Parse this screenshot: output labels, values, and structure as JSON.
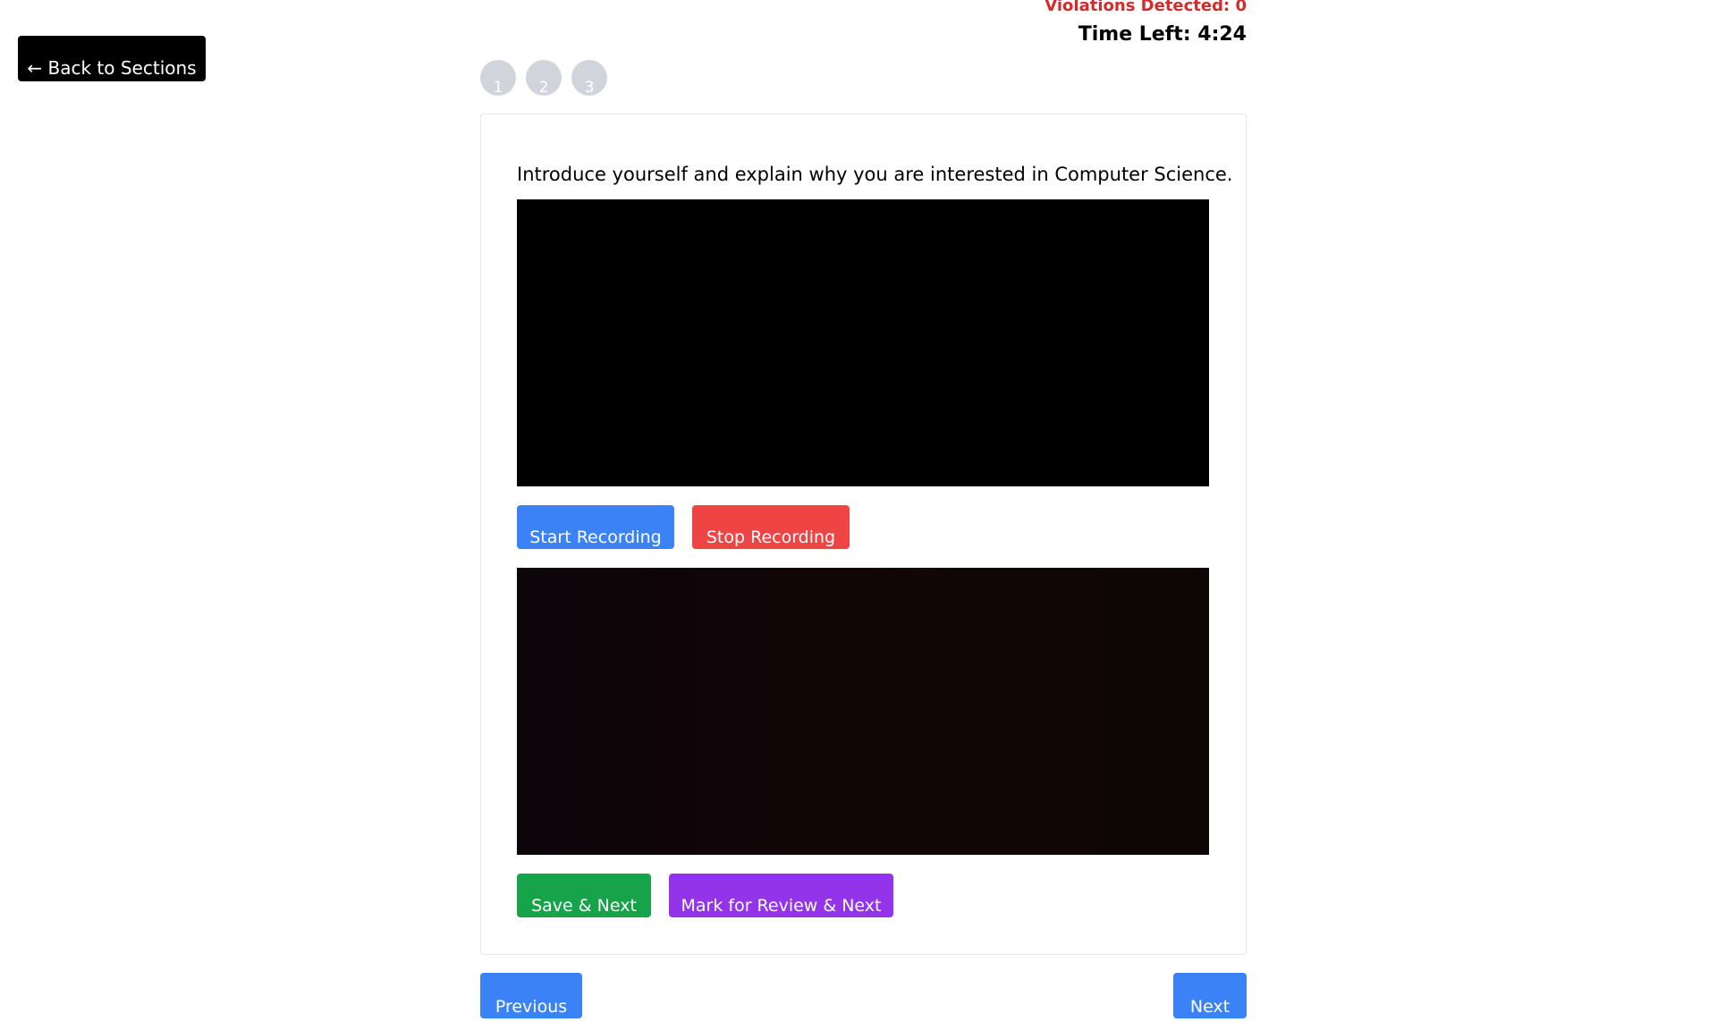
{
  "header": {
    "back_label": "← Back to Sections",
    "violations_text": "Violations Detected: 0",
    "time_left_text": "Time Left: 4:24"
  },
  "question_nav": {
    "items": [
      "1",
      "2",
      "3"
    ]
  },
  "question": {
    "text": "Introduce yourself and explain why you are interested in Computer Science."
  },
  "recording": {
    "start_label": "Start Recording",
    "stop_label": "Stop Recording"
  },
  "actions": {
    "save_next_label": "Save & Next",
    "mark_review_label": "Mark for Review & Next"
  },
  "footer": {
    "previous_label": "Previous",
    "next_label": "Next"
  },
  "colors": {
    "primary": "#3b82f6",
    "danger": "#ef4444",
    "success": "#16a34a",
    "review": "#9333ea",
    "violation": "#d42a2a",
    "nav_dot": "#d1d5db"
  }
}
